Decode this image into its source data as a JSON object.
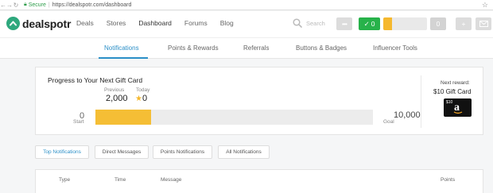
{
  "browser": {
    "secure_label": "Secure",
    "url": "https://dealspotr.com/dashboard"
  },
  "header": {
    "brand": "dealspotr",
    "nav": [
      "Deals",
      "Stores",
      "Dashboard",
      "Forums",
      "Blog"
    ],
    "active_nav": "Dashboard",
    "search_placeholder": "Search",
    "check_count": "0",
    "badge_count": "0",
    "colors": {
      "brand_green": "#2ea87d",
      "check_green": "#27b24a",
      "accent_yellow": "#f5b82e",
      "link_blue": "#2b8fc7"
    }
  },
  "subnav": {
    "items": [
      "Notifications",
      "Points & Rewards",
      "Referrals",
      "Buttons & Badges",
      "Influencer Tools"
    ],
    "active": "Notifications"
  },
  "progress": {
    "title": "Progress to Your Next Gift Card",
    "previous_label": "Previous",
    "previous_value": "2,000",
    "today_label": "Today",
    "today_value": "0",
    "start_value": "0",
    "start_label": "Start",
    "goal_value": "10,000",
    "goal_label": "Goal",
    "fill_fraction": 0.2,
    "next_reward_label": "Next reward:",
    "next_reward_value": "$10 Gift Card",
    "gift_card_amount": "$10",
    "gift_card_brand": "a"
  },
  "notification_tabs": {
    "items": [
      "Top Notifications",
      "Direct Messages",
      "Points Notifications",
      "All Notifications"
    ],
    "active": "Top Notifications"
  },
  "table": {
    "headers": [
      "Type",
      "Time",
      "Message",
      "Points"
    ]
  }
}
